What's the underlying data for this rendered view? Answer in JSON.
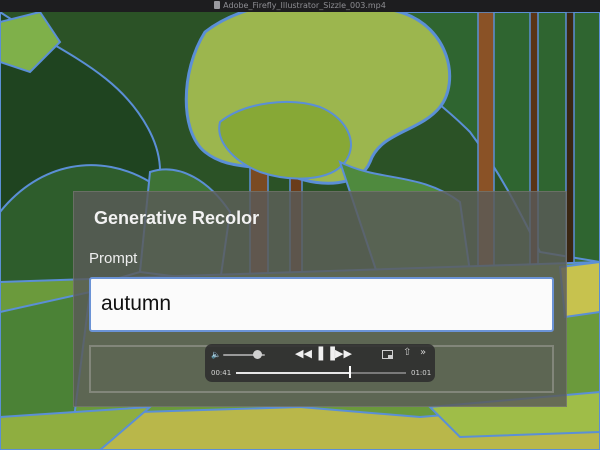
{
  "window": {
    "title": "Adobe_Firefly_Illustrator_Sizzle_003.mp4",
    "doc_icon": "document-icon"
  },
  "panel": {
    "title": "Generative Recolor",
    "prompt_label": "Prompt",
    "prompt_value": "autumn"
  },
  "player": {
    "volume": 0.8,
    "current_time": "00:41",
    "end_time": "01:01",
    "progress": 0.67,
    "icons": [
      "volume-icon",
      "rewind-icon",
      "pause-icon",
      "fast-forward-icon",
      "picture-in-picture-icon",
      "share-icon",
      "more-icon"
    ]
  },
  "colors": {
    "accent": "#6b93d6",
    "outline": "#5b8fd6"
  }
}
